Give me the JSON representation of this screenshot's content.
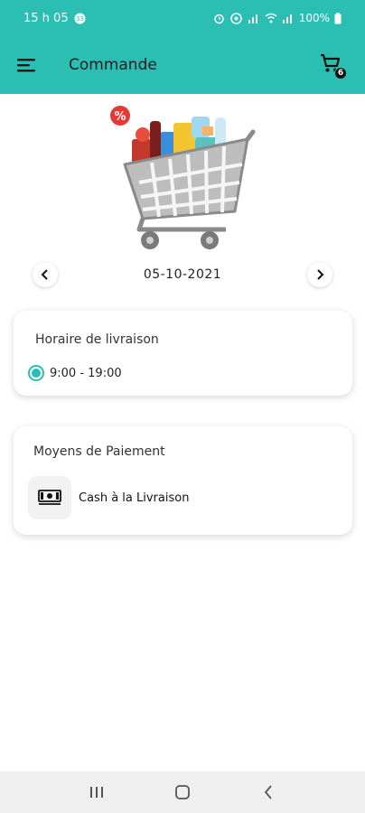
{
  "status_bar": {
    "time": "15 h 05",
    "battery": "100%",
    "icons": [
      "notification-icon",
      "alarm-icon",
      "sim-icon",
      "wifi-icon",
      "signal-icon",
      "battery-icon"
    ]
  },
  "app_bar": {
    "title": "Commande",
    "cart_count": "6",
    "icons": [
      "menu-icon",
      "cart-icon"
    ]
  },
  "date_selector": {
    "date": "05-10-2021",
    "icons": [
      "chevron-left-icon",
      "chevron-right-icon"
    ]
  },
  "schedule": {
    "title": "Horaire de livraison",
    "options": [
      {
        "label": "9:00 - 19:00",
        "selected": true
      }
    ]
  },
  "payment": {
    "title": "Moyens de Paiement",
    "methods": [
      {
        "label": "Cash à la Livraison",
        "icon": "cash-icon"
      }
    ]
  },
  "hero": {
    "badge": "%",
    "icon": "shopping-cart-illustration"
  },
  "colors": {
    "accent": "#2bbfb3",
    "background": "#ffffff",
    "nav_bar": "#efefef"
  }
}
